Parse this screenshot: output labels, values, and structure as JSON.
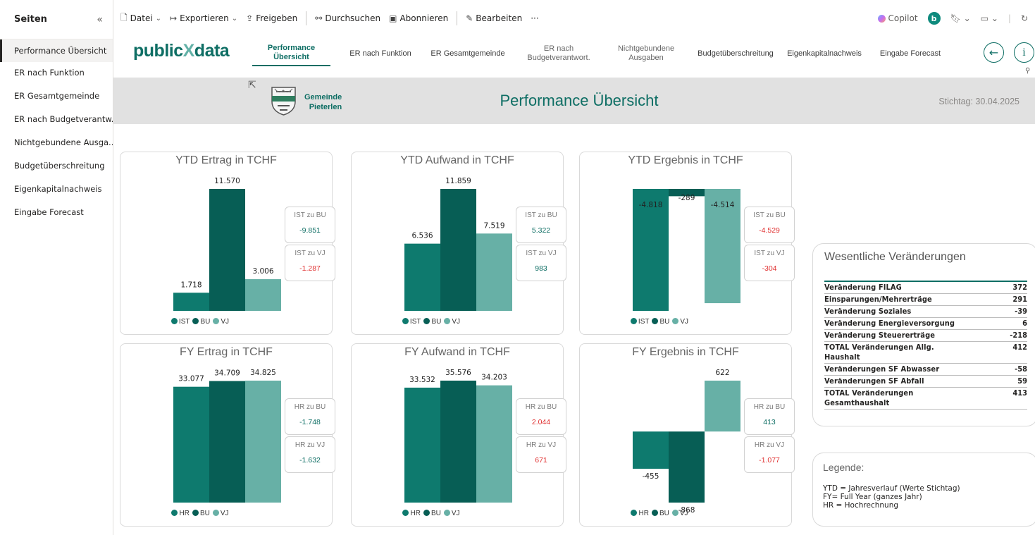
{
  "sidebar": {
    "title": "Seiten",
    "collapse": "«",
    "items": [
      {
        "label": "Performance Übersicht",
        "active": true
      },
      {
        "label": "ER nach Funktion"
      },
      {
        "label": "ER Gesamtgemeinde"
      },
      {
        "label": "ER nach Budgetverantw..."
      },
      {
        "label": "Nichtgebundene Ausga..."
      },
      {
        "label": "Budgetüberschreitung"
      },
      {
        "label": "Eigenkapitalnachweis"
      },
      {
        "label": "Eingabe Forecast"
      }
    ]
  },
  "toolbar": {
    "datei": "Datei",
    "exportieren": "Exportieren",
    "freigeben": "Freigeben",
    "durchsuchen": "Durchsuchen",
    "abonnieren": "Abonnieren",
    "bearbeiten": "Bearbeiten",
    "more": "···",
    "copilot": "Copilot",
    "user_initial": "b"
  },
  "report": {
    "brand_main": "public",
    "brand_x": "X",
    "brand_tail": "data",
    "nav": [
      "Performance\nÜbersicht",
      "ER nach Funktion",
      "ER Gesamtgemeinde",
      "ER nach\nBudgetverantwort.",
      "Nichtgebundene\nAusgaben",
      "Budgetüberschreitung",
      "Eigenkapitalnachweis",
      "Eingabe Forecast"
    ],
    "back_icon": "arrow-left-icon",
    "info_icon": "info-icon",
    "municipality_line1": "Gemeinde",
    "municipality_line2": "Pieterlen",
    "page_title": "Performance Übersicht",
    "stichtag": "Stichtag: 30.04.2025"
  },
  "colors": {
    "ist": "#0e7a6e",
    "bu": "#075e55",
    "vj": "#67b0a6",
    "negative": "#e03131",
    "positive": "#0e6e64"
  },
  "chart_data": [
    {
      "type": "bar",
      "title": "YTD Ertrag in TCHF",
      "categories": [
        "IST",
        "BU",
        "VJ"
      ],
      "values": [
        1718,
        11570,
        3006
      ],
      "labels": [
        "1.718",
        "11.570",
        "3.006"
      ],
      "legend": [
        "IST",
        "BU",
        "VJ"
      ],
      "kpis": [
        {
          "label": "IST zu BU",
          "value": "-9.851",
          "sign": "pos"
        },
        {
          "label": "IST zu VJ",
          "value": "-1.287",
          "sign": "neg"
        }
      ]
    },
    {
      "type": "bar",
      "title": "YTD Aufwand in TCHF",
      "categories": [
        "IST",
        "BU",
        "VJ"
      ],
      "values": [
        6536,
        11859,
        7519
      ],
      "labels": [
        "6.536",
        "11.859",
        "7.519"
      ],
      "legend": [
        "IST",
        "BU",
        "VJ"
      ],
      "kpis": [
        {
          "label": "IST zu BU",
          "value": "5.322",
          "sign": "pos"
        },
        {
          "label": "IST zu VJ",
          "value": "983",
          "sign": "pos"
        }
      ]
    },
    {
      "type": "bar",
      "title": "YTD Ergebnis in TCHF",
      "categories": [
        "IST",
        "BU",
        "VJ"
      ],
      "values": [
        -4818,
        -289,
        -4514
      ],
      "labels": [
        "-4.818",
        "-289",
        "-4.514"
      ],
      "legend": [
        "IST",
        "BU",
        "VJ"
      ],
      "kpis": [
        {
          "label": "IST zu BU",
          "value": "-4.529",
          "sign": "neg"
        },
        {
          "label": "IST zu VJ",
          "value": "-304",
          "sign": "neg"
        }
      ]
    },
    {
      "type": "bar",
      "title": "FY Ertrag in TCHF",
      "categories": [
        "HR",
        "BU",
        "VJ"
      ],
      "values": [
        33077,
        34709,
        34825
      ],
      "labels": [
        "33.077",
        "34.709",
        "34.825"
      ],
      "legend": [
        "HR",
        "BU",
        "VJ"
      ],
      "kpis": [
        {
          "label": "HR zu BU",
          "value": "-1.748",
          "sign": "pos"
        },
        {
          "label": "HR zu VJ",
          "value": "-1.632",
          "sign": "pos"
        }
      ]
    },
    {
      "type": "bar",
      "title": "FY Aufwand in TCHF",
      "categories": [
        "HR",
        "BU",
        "VJ"
      ],
      "values": [
        33532,
        35576,
        34203
      ],
      "labels": [
        "33.532",
        "35.576",
        "34.203"
      ],
      "legend": [
        "HR",
        "BU",
        "VJ"
      ],
      "kpis": [
        {
          "label": "HR zu BU",
          "value": "2.044",
          "sign": "neg"
        },
        {
          "label": "HR zu VJ",
          "value": "671",
          "sign": "neg"
        }
      ]
    },
    {
      "type": "bar",
      "title": "FY Ergebnis in TCHF",
      "categories": [
        "HR",
        "BU",
        "VJ"
      ],
      "values": [
        -455,
        -868,
        622
      ],
      "labels": [
        "-455",
        "-868",
        "622"
      ],
      "legend": [
        "HR",
        "BU",
        "VJ"
      ],
      "kpis": [
        {
          "label": "HR zu BU",
          "value": "413",
          "sign": "pos"
        },
        {
          "label": "HR zu VJ",
          "value": "-1.077",
          "sign": "neg"
        }
      ]
    }
  ],
  "changes": {
    "title": "Wesentliche Veränderungen",
    "rows": [
      {
        "name": "Veränderung FILAG",
        "value": "372"
      },
      {
        "name": "Einsparungen/Mehrerträge",
        "value": "291"
      },
      {
        "name": "Veränderung Soziales",
        "value": "-39"
      },
      {
        "name": "Veränderung Energieversorgung",
        "value": "6"
      },
      {
        "name": "Veränderung Steuererträge",
        "value": "-218"
      },
      {
        "name": "TOTAL Veränderungen Allg. Haushalt",
        "value": "412"
      },
      {
        "name": "Veränderungen SF Abwasser",
        "value": "-58"
      },
      {
        "name": "Veränderungen SF Abfall",
        "value": "59"
      },
      {
        "name": "TOTAL Veränderungen Gesamthaushalt",
        "value": "413"
      }
    ]
  },
  "legende": {
    "title": "Legende:",
    "lines": [
      "YTD = Jahresverlauf (Werte Stichtag)",
      "FY= Full Year (ganzes Jahr)",
      "HR = Hochrechnung"
    ]
  }
}
